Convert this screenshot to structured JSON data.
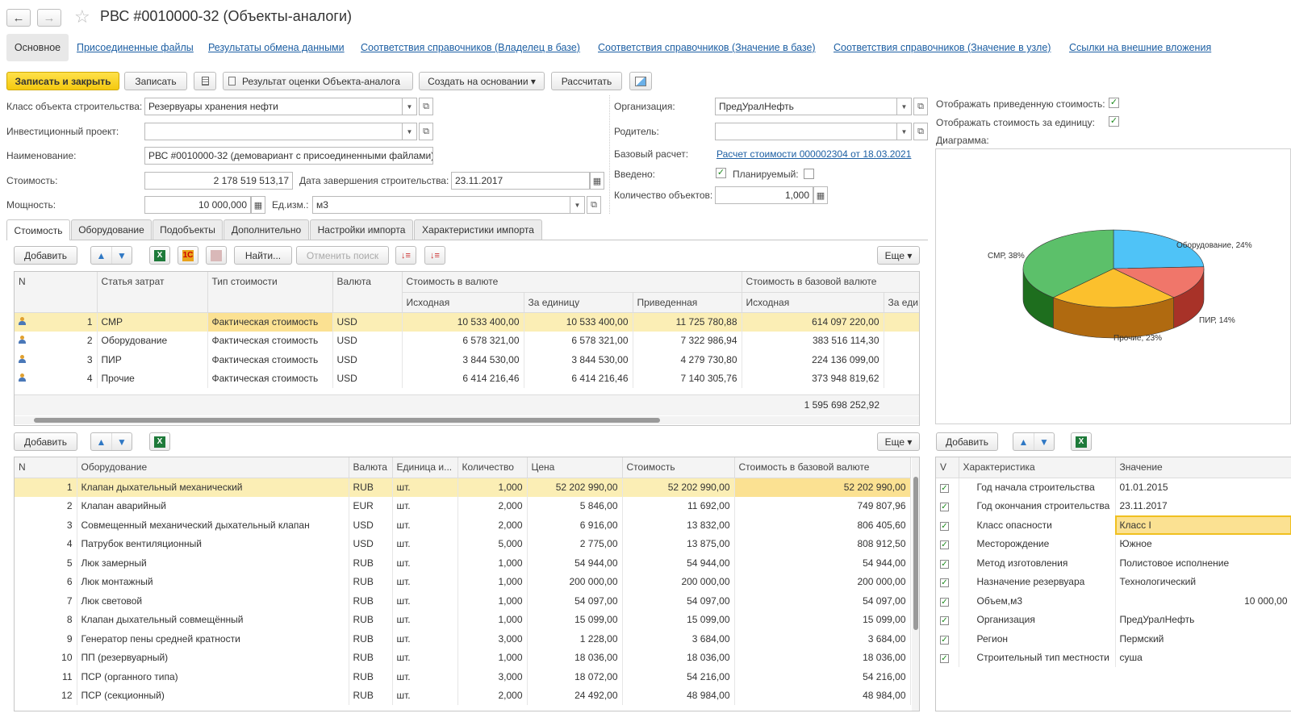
{
  "window": {
    "title": "РВС #0010000-32  (Объекты-аналоги)",
    "back_icon": "←",
    "forward_icon": "→",
    "star_icon": "☆"
  },
  "nav_tabs": {
    "main": "Основное",
    "links": [
      "Присоединенные файлы",
      "Результаты обмена данными",
      "Соответствия справочников (Владелец в базе)",
      "Соответствия справочников (Значение в базе)",
      "Соответствия справочников (Значение в узле)",
      "Ссылки на внешние вложения"
    ]
  },
  "toolbar": {
    "save_close": "Записать и закрыть",
    "save": "Записать",
    "report": "Результат оценки Объекта-аналога",
    "create_based": "Создать на основании ▾",
    "calculate": "Рассчитать"
  },
  "form": {
    "class_label": "Класс объекта строительства:",
    "class_value": "Резервуары хранения нефти",
    "invest_label": "Инвестиционный проект:",
    "invest_value": "",
    "name_label": "Наименование:",
    "name_value": "РВС #0010000-32  (демовариант с присоединенными файлами)",
    "cost_label": "Стоимость:",
    "cost_value": "2 178 519 513,17",
    "date_label": "Дата завершения строительства:",
    "date_value": "23.11.2017",
    "power_label": "Мощность:",
    "power_value": "10 000,000",
    "unit_label": "Ед.изм.:",
    "unit_value": "м3",
    "org_label": "Организация:",
    "org_value": "ПредУралНефть",
    "parent_label": "Родитель:",
    "parent_value": "",
    "base_calc_label": "Базовый расчет:",
    "base_calc_value": "Расчет стоимости 000002304 от 18.03.2021",
    "entered_label": "Введено:",
    "planned_label": "Планируемый:",
    "qty_label": "Количество объектов:",
    "qty_value": "1,000",
    "show_reduced": "Отображать приведенную стоимость:",
    "show_per_unit": "Отображать стоимость за единицу:",
    "diagram_label": "Диаграмма:"
  },
  "panel_tabs": [
    "Стоимость",
    "Оборудование",
    "Подобъекты",
    "Дополнительно",
    "Настройки импорта",
    "Характеристики импорта"
  ],
  "cost_toolbar": {
    "add": "Добавить",
    "find": "Найти...",
    "cancel_search": "Отменить поиск",
    "more": "Еще ▾"
  },
  "cost_table": {
    "headers_top": [
      "N",
      "Статья затрат",
      "Тип стоимости",
      "Валюта",
      "Стоимость в валюте",
      "Стоимость в базовой валюте"
    ],
    "headers_sub": [
      "Исходная",
      "За единицу",
      "Приведенная",
      "Исходная",
      "За еди"
    ],
    "rows": [
      {
        "n": "1",
        "item": "СМР",
        "type": "Фактическая стоимость",
        "cur": "USD",
        "src": "10 533 400,00",
        "unit": "10 533 400,00",
        "red": "11 725 780,88",
        "base": "614 097 220,00"
      },
      {
        "n": "2",
        "item": "Оборудование",
        "type": "Фактическая стоимость",
        "cur": "USD",
        "src": "6 578 321,00",
        "unit": "6 578 321,00",
        "red": "7 322 986,94",
        "base": "383 516 114,30"
      },
      {
        "n": "3",
        "item": "ПИР",
        "type": "Фактическая стоимость",
        "cur": "USD",
        "src": "3 844 530,00",
        "unit": "3 844 530,00",
        "red": "4 279 730,80",
        "base": "224 136 099,00"
      },
      {
        "n": "4",
        "item": "Прочие",
        "type": "Фактическая стоимость",
        "cur": "USD",
        "src": "6 414 216,46",
        "unit": "6 414 216,46",
        "red": "7 140 305,76",
        "base": "373 948 819,62"
      }
    ],
    "total_base": "1 595 698 252,92"
  },
  "equip_toolbar": {
    "add": "Добавить",
    "more": "Еще ▾"
  },
  "equip_table": {
    "headers": [
      "N",
      "Оборудование",
      "Валюта",
      "Единица и...",
      "Количество",
      "Цена",
      "Стоимость",
      "Стоимость в базовой валюте"
    ],
    "rows": [
      {
        "n": "1",
        "name": "Клапан дыхательный механический",
        "cur": "RUB",
        "unit": "шт.",
        "qty": "1,000",
        "price": "52 202 990,00",
        "cost": "52 202 990,00",
        "base": "52 202 990,00"
      },
      {
        "n": "2",
        "name": "Клапан аварийный",
        "cur": "EUR",
        "unit": "шт.",
        "qty": "2,000",
        "price": "5 846,00",
        "cost": "11 692,00",
        "base": "749 807,96"
      },
      {
        "n": "3",
        "name": "Совмещенный механический дыхательный клапан",
        "cur": "USD",
        "unit": "шт.",
        "qty": "2,000",
        "price": "6 916,00",
        "cost": "13 832,00",
        "base": "806 405,60"
      },
      {
        "n": "4",
        "name": "Патрубок вентиляционный",
        "cur": "USD",
        "unit": "шт.",
        "qty": "5,000",
        "price": "2 775,00",
        "cost": "13 875,00",
        "base": "808 912,50"
      },
      {
        "n": "5",
        "name": "Люк замерный",
        "cur": "RUB",
        "unit": "шт.",
        "qty": "1,000",
        "price": "54 944,00",
        "cost": "54 944,00",
        "base": "54 944,00"
      },
      {
        "n": "6",
        "name": "Люк монтажный",
        "cur": "RUB",
        "unit": "шт.",
        "qty": "1,000",
        "price": "200 000,00",
        "cost": "200 000,00",
        "base": "200 000,00"
      },
      {
        "n": "7",
        "name": "Люк световой",
        "cur": "RUB",
        "unit": "шт.",
        "qty": "1,000",
        "price": "54 097,00",
        "cost": "54 097,00",
        "base": "54 097,00"
      },
      {
        "n": "8",
        "name": "Клапан дыхательный совмещённый",
        "cur": "RUB",
        "unit": "шт.",
        "qty": "1,000",
        "price": "15 099,00",
        "cost": "15 099,00",
        "base": "15 099,00"
      },
      {
        "n": "9",
        "name": "Генератор пены средней кратности",
        "cur": "RUB",
        "unit": "шт.",
        "qty": "3,000",
        "price": "1 228,00",
        "cost": "3 684,00",
        "base": "3 684,00"
      },
      {
        "n": "10",
        "name": "ПП (резервуарный)",
        "cur": "RUB",
        "unit": "шт.",
        "qty": "1,000",
        "price": "18 036,00",
        "cost": "18 036,00",
        "base": "18 036,00"
      },
      {
        "n": "11",
        "name": "ПСР (органного типа)",
        "cur": "RUB",
        "unit": "шт.",
        "qty": "3,000",
        "price": "18 072,00",
        "cost": "54 216,00",
        "base": "54 216,00"
      },
      {
        "n": "12",
        "name": "ПСР (секционный)",
        "cur": "RUB",
        "unit": "шт.",
        "qty": "2,000",
        "price": "24 492,00",
        "cost": "48 984,00",
        "base": "48 984,00"
      }
    ]
  },
  "char_toolbar": {
    "add": "Добавить"
  },
  "char_table": {
    "headers": [
      "V",
      "Характеристика",
      "Значение"
    ],
    "rows": [
      {
        "name": "Год начала строительства",
        "value": "01.01.2015",
        "num": false
      },
      {
        "name": "Год окончания строительства",
        "value": "23.11.2017",
        "num": false
      },
      {
        "name": "Класс опасности",
        "value": "Класс I",
        "num": false
      },
      {
        "name": "Месторождение",
        "value": "Южное",
        "num": false
      },
      {
        "name": "Метод изготовления",
        "value": "Полистовое исполнение",
        "num": false
      },
      {
        "name": "Назначение резервуара",
        "value": "Технологический",
        "num": false
      },
      {
        "name": "Объем,м3",
        "value": "10 000,00",
        "num": true
      },
      {
        "name": "Организация",
        "value": "ПредУралНефть",
        "num": false
      },
      {
        "name": "Регион",
        "value": "Пермский",
        "num": false
      },
      {
        "name": "Строительный тип местности",
        "value": "суша",
        "num": false
      }
    ]
  },
  "chart_data": {
    "type": "pie",
    "categories": [
      "СМР",
      "Оборудование",
      "ПИР",
      "Прочие"
    ],
    "values": [
      38,
      24,
      14,
      23
    ],
    "labels": [
      "СМР, 38%",
      "Оборудование, 24%",
      "ПИР, 14%",
      "Прочие, 23%"
    ],
    "colors": [
      "#5cc06a",
      "#4fc3f7",
      "#f0766a",
      "#fbc02d"
    ],
    "side_colors": [
      "#1e6e1e",
      "#2a8fc0",
      "#a83228",
      "#b06a10"
    ]
  }
}
